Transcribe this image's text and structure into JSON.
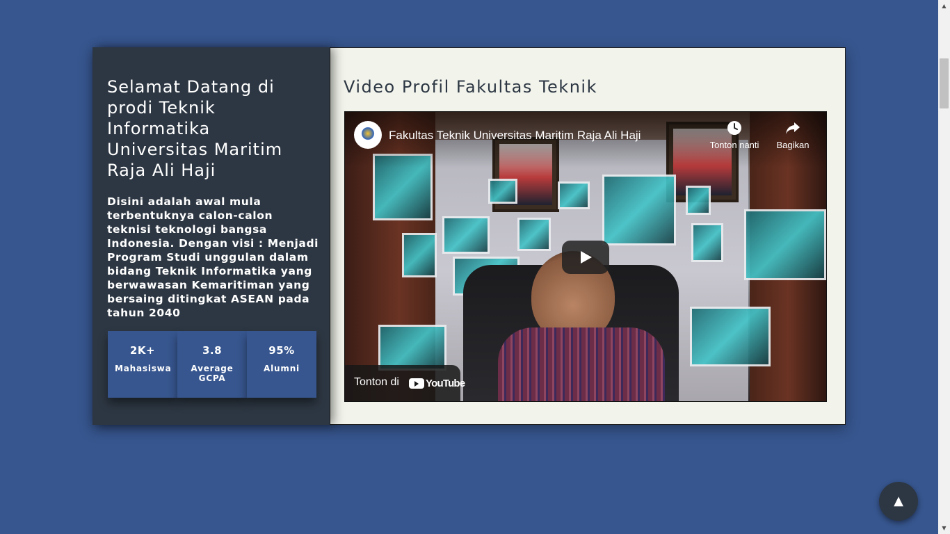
{
  "welcome": {
    "title": "Selamat Datang di prodi Teknik Informatika Universitas Maritim Raja Ali Haji",
    "description": "Disini adalah awal mula terbentuknya calon-calon teknisi teknologi bangsa Indonesia. Dengan visi : Menjadi Program Studi unggulan dalam bidang Teknik Informatika yang berwawasan Kemaritiman yang bersaing ditingkat ASEAN pada tahun 2040"
  },
  "stats": [
    {
      "value": "2K+",
      "label": "Mahasiswa"
    },
    {
      "value": "3.8",
      "label": "Average GCPA"
    },
    {
      "value": "95%",
      "label": "Alumni"
    }
  ],
  "video_section": {
    "heading": "Video Profil Fakultas Teknik",
    "embed": {
      "title": "Fakultas Teknik Universitas Maritim Raja Ali Haji",
      "watch_later_label": "Tonton nanti",
      "share_label": "Bagikan",
      "watch_on_label": "Tonton di",
      "youtube_wordmark": "YouTube",
      "play_icon": "play-icon",
      "channel_icon": "channel-logo"
    }
  },
  "scroll_top": {
    "label": "▲"
  },
  "colors": {
    "page_background": "#37568f",
    "left_panel": "#2d3743",
    "stat_box": "#37568f",
    "right_panel": "#f2f4ec",
    "heading_text": "#2d3743"
  }
}
